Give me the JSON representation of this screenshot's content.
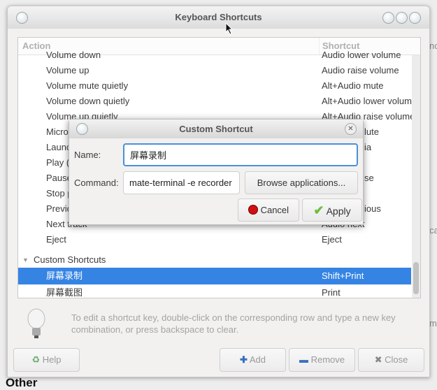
{
  "window": {
    "title": "Keyboard Shortcuts"
  },
  "tree": {
    "headers": {
      "action": "Action",
      "shortcut": "Shortcut"
    },
    "rows": [
      {
        "action": "Volume down",
        "shortcut": "Audio lower volume"
      },
      {
        "action": "Volume up",
        "shortcut": "Audio raise volume"
      },
      {
        "action": "Volume mute quietly",
        "shortcut": "Alt+Audio mute"
      },
      {
        "action": "Volume down quietly",
        "shortcut": "Alt+Audio lower volume"
      },
      {
        "action": "Volume up quietly",
        "shortcut": "Alt+Audio raise volume"
      },
      {
        "action": "Micro",
        "shortcut": "lute"
      },
      {
        "action": "Launc",
        "shortcut": "ia"
      },
      {
        "action": "Play (",
        "shortcut": ""
      },
      {
        "action": "Pause",
        "shortcut": "se"
      },
      {
        "action": "Stop p",
        "shortcut": ""
      },
      {
        "action": "Previo",
        "shortcut": "ious"
      },
      {
        "action": "Next track",
        "shortcut": "Audio next"
      },
      {
        "action": "Eject",
        "shortcut": "Eject"
      }
    ],
    "group": "Custom Shortcuts",
    "custom": [
      {
        "action": "屏幕录制",
        "shortcut": "Shift+Print",
        "selected": true
      },
      {
        "action": "屏幕截图",
        "shortcut": "Print"
      }
    ]
  },
  "hint": "To edit a shortcut key, double-click on the corresponding row and type a new key combination, or press backspace to clear.",
  "buttons": {
    "help": "Help",
    "add": "Add",
    "remove": "Remove",
    "close": "Close"
  },
  "dialog": {
    "title": "Custom Shortcut",
    "name_label": "Name:",
    "name_value": "屏幕录制",
    "command_label": "Command:",
    "command_value": "mate-terminal -e recorder",
    "browse": "Browse applications...",
    "cancel": "Cancel",
    "apply": "Apply"
  },
  "background": {
    "heading": "Other",
    "side_text_1": "no",
    "side_text_2": "ca",
    "side_text_3": "m"
  },
  "colors": {
    "selection": "#3584e4"
  }
}
